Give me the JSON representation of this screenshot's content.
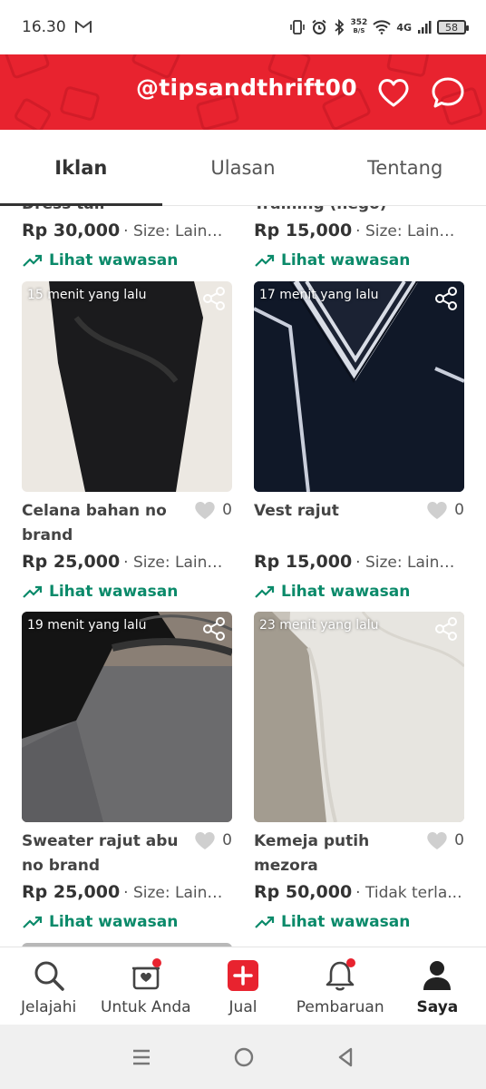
{
  "status_bar": {
    "time": "16.30",
    "speed_value": "352",
    "speed_unit": "B/S",
    "network": "4G",
    "battery": "58"
  },
  "header": {
    "username": "@tipsandthrift00",
    "brand_color": "#e8232f"
  },
  "tabs": [
    {
      "label": "Iklan",
      "active": true
    },
    {
      "label": "Ulasan",
      "active": false
    },
    {
      "label": "Tentang",
      "active": false
    }
  ],
  "partial_row": [
    {
      "title_fragment": "Dress tali",
      "price": "Rp 30,000",
      "size": "· Size: Lainnya",
      "insight": "Lihat wawasan"
    },
    {
      "title_fragment": "Training (nego)",
      "price": "Rp 15,000",
      "size": "· Size: Lainnya",
      "insight": "Lihat wawasan"
    }
  ],
  "listings": [
    {
      "time": "15 menit yang lalu",
      "title": "Celana bahan no brand",
      "likes": "0",
      "price": "Rp 25,000",
      "size": "· Size: Lainnya",
      "insight": "Lihat wawasan"
    },
    {
      "time": "17 menit yang lalu",
      "title": "Vest rajut",
      "likes": "0",
      "price": "Rp 15,000",
      "size": "· Size: Lainnya",
      "insight": "Lihat wawasan"
    },
    {
      "time": "19 menit yang lalu",
      "title": "Sweater rajut abu no brand",
      "likes": "0",
      "price": "Rp 25,000",
      "size": "· Size: Lainnya",
      "insight": "Lihat wawasan"
    },
    {
      "time": "23 menit yang lalu",
      "title": "Kemeja putih mezora",
      "likes": "0",
      "price": "Rp 50,000",
      "size": "· Tidak terla...",
      "insight": "Lihat wawasan"
    }
  ],
  "bottom_nav": [
    {
      "label": "Jelajahi",
      "icon": "search-icon"
    },
    {
      "label": "Untuk Anda",
      "icon": "gift-box-icon"
    },
    {
      "label": "Jual",
      "icon": "plus-icon"
    },
    {
      "label": "Pembaruan",
      "icon": "bell-icon"
    },
    {
      "label": "Saya",
      "icon": "user-icon"
    }
  ],
  "colors": {
    "insight": "#0b8a6a",
    "notification_dot": "#e8232f"
  }
}
